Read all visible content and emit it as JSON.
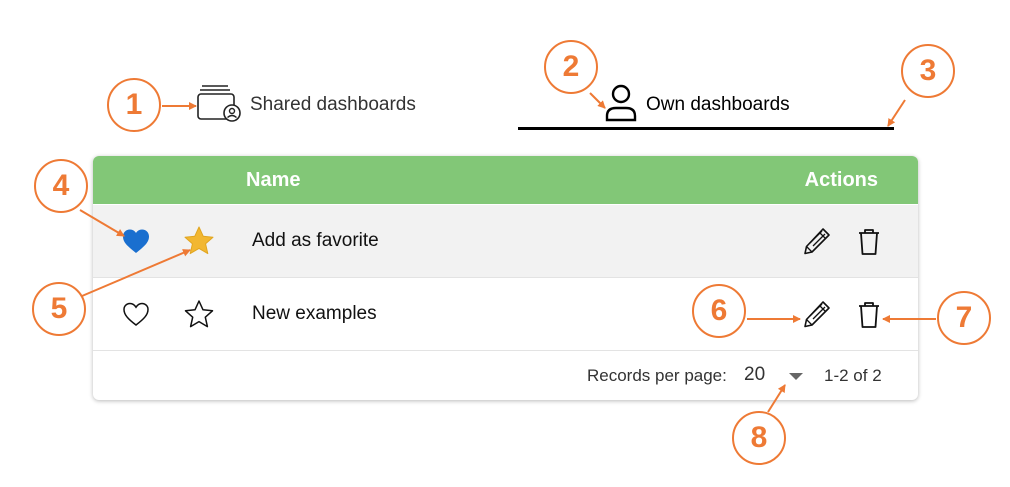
{
  "tabs": {
    "shared": {
      "label": "Shared dashboards",
      "icon": "shared-dashboards-icon"
    },
    "own": {
      "label": "Own dashboards",
      "icon": "user-icon",
      "active": true
    }
  },
  "table": {
    "headers": {
      "name": "Name",
      "actions": "Actions"
    },
    "rows": [
      {
        "name": "Add as favorite",
        "favorite": true,
        "starred": true
      },
      {
        "name": "New examples",
        "favorite": false,
        "starred": false
      }
    ]
  },
  "pagination": {
    "label": "Records per page:",
    "per_page": "20",
    "range": "1-2 of 2"
  },
  "callouts": [
    "1",
    "2",
    "3",
    "4",
    "5",
    "6",
    "7",
    "8"
  ],
  "colors": {
    "header_green": "#82c777",
    "callout_orange": "#ee7a35",
    "heart_blue": "#1a6fcf",
    "star_gold": "#f2b731"
  }
}
